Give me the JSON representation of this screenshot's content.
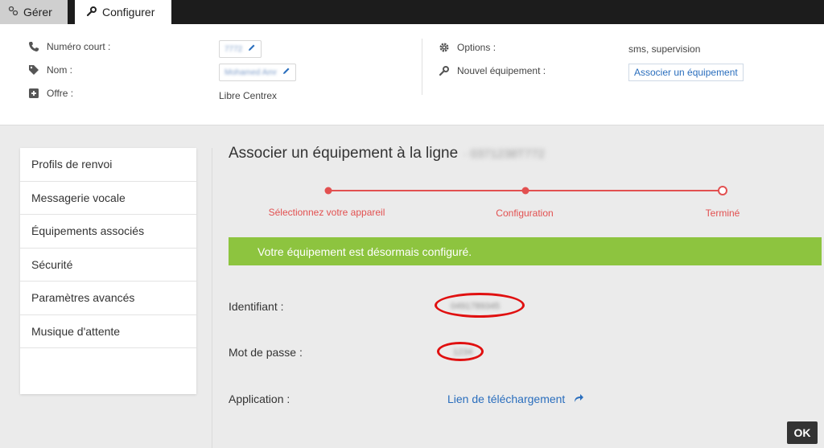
{
  "tabs": {
    "gerer": "Gérer",
    "configurer": "Configurer"
  },
  "info": {
    "numero_label": "Numéro court :",
    "numero_value": "7772",
    "nom_label": "Nom :",
    "nom_value": "Mohamed Amr",
    "offre_label": "Offre :",
    "offre_value": "Libre Centrex",
    "options_label": "Options :",
    "options_value": "sms, supervision",
    "nouvel_label": "Nouvel équipement :",
    "associer_button": "Associer un équipement"
  },
  "sidebar": {
    "items": [
      {
        "label": "Profils de renvoi"
      },
      {
        "label": "Messagerie vocale"
      },
      {
        "label": "Équipements associés"
      },
      {
        "label": "Sécurité"
      },
      {
        "label": "Paramètres avancés"
      },
      {
        "label": "Musique d'attente"
      }
    ]
  },
  "main": {
    "title": "Associer un équipement à la ligne",
    "title_number": "· 0371238T772",
    "steps": [
      "Sélectionnez votre appareil",
      "Configuration",
      "Terminé"
    ],
    "success_message": "Votre équipement est désormais configuré.",
    "identifiant_label": "Identifiant :",
    "identifiant_value": "0491789345",
    "password_label": "Mot de passe :",
    "password_value": "1234",
    "application_label": "Application :",
    "download_link": "Lien de téléchargement",
    "ok_button": "OK"
  },
  "colors": {
    "accent_red": "#e25050",
    "success_green": "#8dc43f",
    "link_blue": "#2a6ebd"
  }
}
